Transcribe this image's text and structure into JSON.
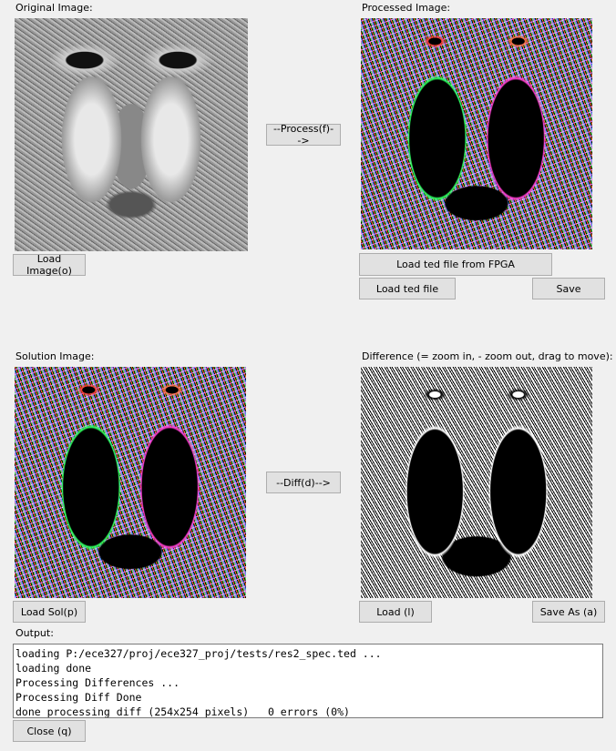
{
  "labels": {
    "original": "Original Image:",
    "processed": "Processed Image:",
    "solution": "Solution Image:",
    "difference": "Difference (= zoom in, - zoom out, drag to move):",
    "output": "Output:"
  },
  "buttons": {
    "load_image": "Load Image(o)",
    "process": "--Process(f)-->",
    "load_ted_fpga": "Load ted file from FPGA",
    "load_ted": "Load ted file",
    "save": "Save",
    "load_sol": "Load Sol(p)",
    "diff": "--Diff(d)-->",
    "load": "Load (l)",
    "save_as": "Save As (a)",
    "close": "Close (q)"
  },
  "images": {
    "original": "grayscale mandrill image",
    "processed": "edge-detected colorized mandrill image",
    "solution": "edge-detected colorized mandrill image",
    "difference": "black and white difference mandrill image"
  },
  "output_lines": [
    "loading P:/ece327/proj/ece327_proj/tests/res2_spec.ted ...",
    "loading done",
    "Processing Differences ...",
    "Processing Diff Done",
    "done processing diff (254x254 pixels)   0 errors (0%)"
  ]
}
